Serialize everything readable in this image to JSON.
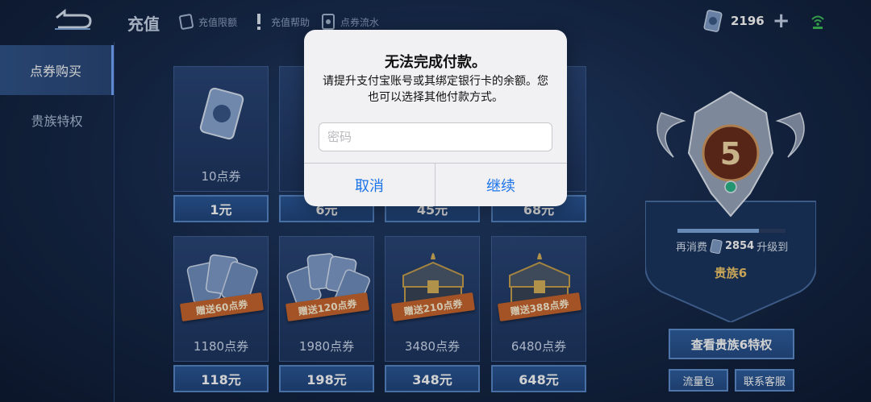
{
  "header": {
    "title": "充值",
    "links": [
      {
        "label": "充值限额",
        "icon": "card-limit-icon"
      },
      {
        "label": "充值帮助",
        "icon": "exclamation-icon"
      },
      {
        "label": "点券流水",
        "icon": "coupon-flow-icon"
      }
    ],
    "balance": "2196"
  },
  "sidebar": {
    "items": [
      {
        "label": "点券购买",
        "active": true
      },
      {
        "label": "贵族特权",
        "active": false
      }
    ]
  },
  "products": [
    {
      "name": "10点券",
      "price": "1元",
      "bonus": ""
    },
    {
      "name": "",
      "price": "6元",
      "bonus": ""
    },
    {
      "name": "",
      "price": "45元",
      "bonus": ""
    },
    {
      "name": "",
      "price": "68元",
      "bonus": ""
    },
    {
      "name": "1180点券",
      "price": "118元",
      "bonus": "赠送60点券"
    },
    {
      "name": "1980点券",
      "price": "198元",
      "bonus": "赠送120点券"
    },
    {
      "name": "3480点券",
      "price": "348元",
      "bonus": "赠送210点券"
    },
    {
      "name": "6480点券",
      "price": "648元",
      "bonus": "赠送388点券"
    }
  ],
  "vip": {
    "level": "5",
    "progress_fraction": 0.75,
    "spend_prefix": "再消费",
    "spend_amount": "2854",
    "spend_suffix": "升级到",
    "next_level": "贵族6",
    "view_button": "查看贵族6特权",
    "flow_button": "流量包",
    "service_button": "联系客服"
  },
  "dialog": {
    "title": "无法完成付款。",
    "message": "请提升支付宝账号或其绑定银行卡的余额。您也可以选择其他付款方式。",
    "password_placeholder": "密码",
    "cancel": "取消",
    "continue": "继续"
  },
  "colors": {
    "accent": "#1a73e8",
    "gold": "#f1c76b",
    "ribbon": "#c7662f"
  }
}
